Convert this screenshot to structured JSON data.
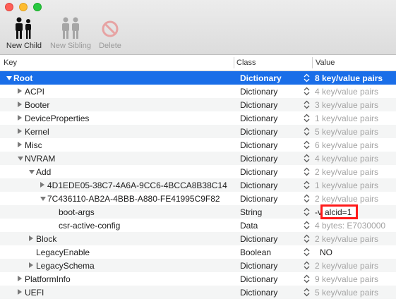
{
  "window": {
    "controls": {
      "close": "close-button",
      "minimize": "minimize-button",
      "zoom": "zoom-button"
    }
  },
  "toolbar": {
    "new_child": "New Child",
    "new_sibling": "New Sibling",
    "delete": "Delete"
  },
  "columns": {
    "key": "Key",
    "class": "Class",
    "value": "Value"
  },
  "rows": [
    {
      "key": "Root",
      "class": "Dictionary",
      "value": "8 key/value pairs"
    },
    {
      "key": "ACPI",
      "class": "Dictionary",
      "value": "4 key/value pairs"
    },
    {
      "key": "Booter",
      "class": "Dictionary",
      "value": "3 key/value pairs"
    },
    {
      "key": "DeviceProperties",
      "class": "Dictionary",
      "value": "1 key/value pairs"
    },
    {
      "key": "Kernel",
      "class": "Dictionary",
      "value": "5 key/value pairs"
    },
    {
      "key": "Misc",
      "class": "Dictionary",
      "value": "6 key/value pairs"
    },
    {
      "key": "NVRAM",
      "class": "Dictionary",
      "value": "4 key/value pairs"
    },
    {
      "key": "Add",
      "class": "Dictionary",
      "value": "2 key/value pairs"
    },
    {
      "key": "4D1EDE05-38C7-4A6A-9CC6-4BCCA8B38C14",
      "class": "Dictionary",
      "value": "1 key/value pairs"
    },
    {
      "key": "7C436110-AB2A-4BBB-A880-FE41995C9F82",
      "class": "Dictionary",
      "value": "2 key/value pairs"
    },
    {
      "key": "boot-args",
      "class": "String",
      "value": "-v"
    },
    {
      "key": "csr-active-config",
      "class": "Data",
      "value": "4 bytes: E7030000"
    },
    {
      "key": "Block",
      "class": "Dictionary",
      "value": "2 key/value pairs"
    },
    {
      "key": "LegacyEnable",
      "class": "Boolean",
      "value": "NO"
    },
    {
      "key": "LegacySchema",
      "class": "Dictionary",
      "value": "2 key/value pairs"
    },
    {
      "key": "PlatformInfo",
      "class": "Dictionary",
      "value": "9 key/value pairs"
    },
    {
      "key": "UEFI",
      "class": "Dictionary",
      "value": "5 key/value pairs"
    }
  ],
  "highlight": {
    "text": "alcid=1",
    "color": "#ff1a1a"
  },
  "colors": {
    "selection": "#1a6ee8",
    "dim_value": "#a3a3a3"
  }
}
